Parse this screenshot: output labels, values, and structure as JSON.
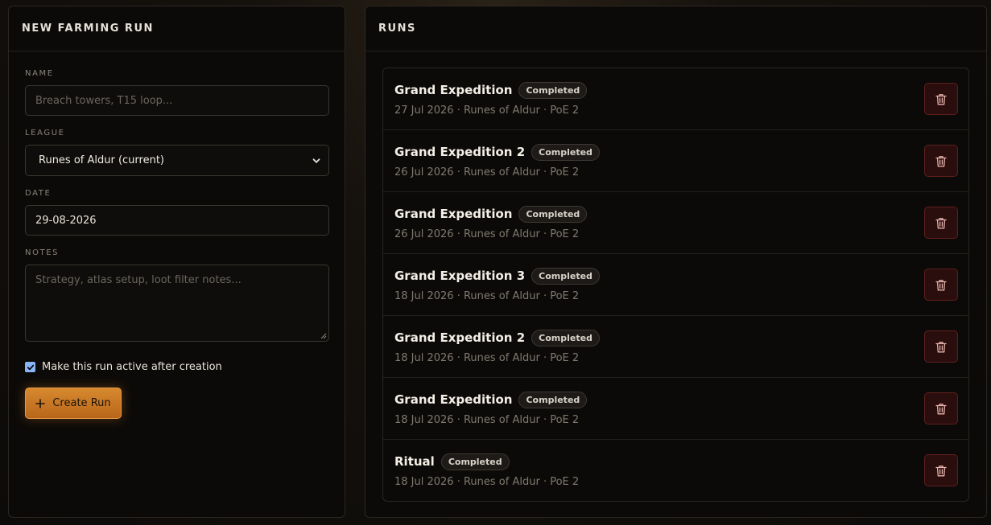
{
  "new_run": {
    "header": "NEW FARMING RUN",
    "name_label": "NAME",
    "name_placeholder": "Breach towers, T15 loop...",
    "league_label": "LEAGUE",
    "league_value": "Runes of Aldur (current)",
    "date_label": "DATE",
    "date_value": "29-08-2026",
    "notes_label": "NOTES",
    "notes_placeholder": "Strategy, atlas setup, loot filter notes...",
    "active_checkbox_label": "Make this run active after creation",
    "active_checked": true,
    "create_button_label": "Create Run"
  },
  "runs": {
    "header": "RUNS",
    "items": [
      {
        "name": "Grand Expedition",
        "status": "Completed",
        "meta": "27 Jul 2026 · Runes of Aldur · PoE 2"
      },
      {
        "name": "Grand Expedition 2",
        "status": "Completed",
        "meta": "26 Jul 2026 · Runes of Aldur · PoE 2"
      },
      {
        "name": "Grand Expedition",
        "status": "Completed",
        "meta": "26 Jul 2026 · Runes of Aldur · PoE 2"
      },
      {
        "name": "Grand Expedition 3",
        "status": "Completed",
        "meta": "18 Jul 2026 · Runes of Aldur · PoE 2"
      },
      {
        "name": "Grand Expedition 2",
        "status": "Completed",
        "meta": "18 Jul 2026 · Runes of Aldur · PoE 2"
      },
      {
        "name": "Grand Expedition",
        "status": "Completed",
        "meta": "18 Jul 2026 · Runes of Aldur · PoE 2"
      },
      {
        "name": "Ritual",
        "status": "Completed",
        "meta": "18 Jul 2026 · Runes of Aldur · PoE 2"
      }
    ]
  },
  "icons": {
    "delete": "trash-icon",
    "create": "plus-icon",
    "select": "chevron-down-icon"
  },
  "colors": {
    "accent": "#d7892f",
    "danger_bg": "#2a0e0d",
    "danger_border": "#5e1f1c",
    "checkbox": "#8ab4f8"
  }
}
